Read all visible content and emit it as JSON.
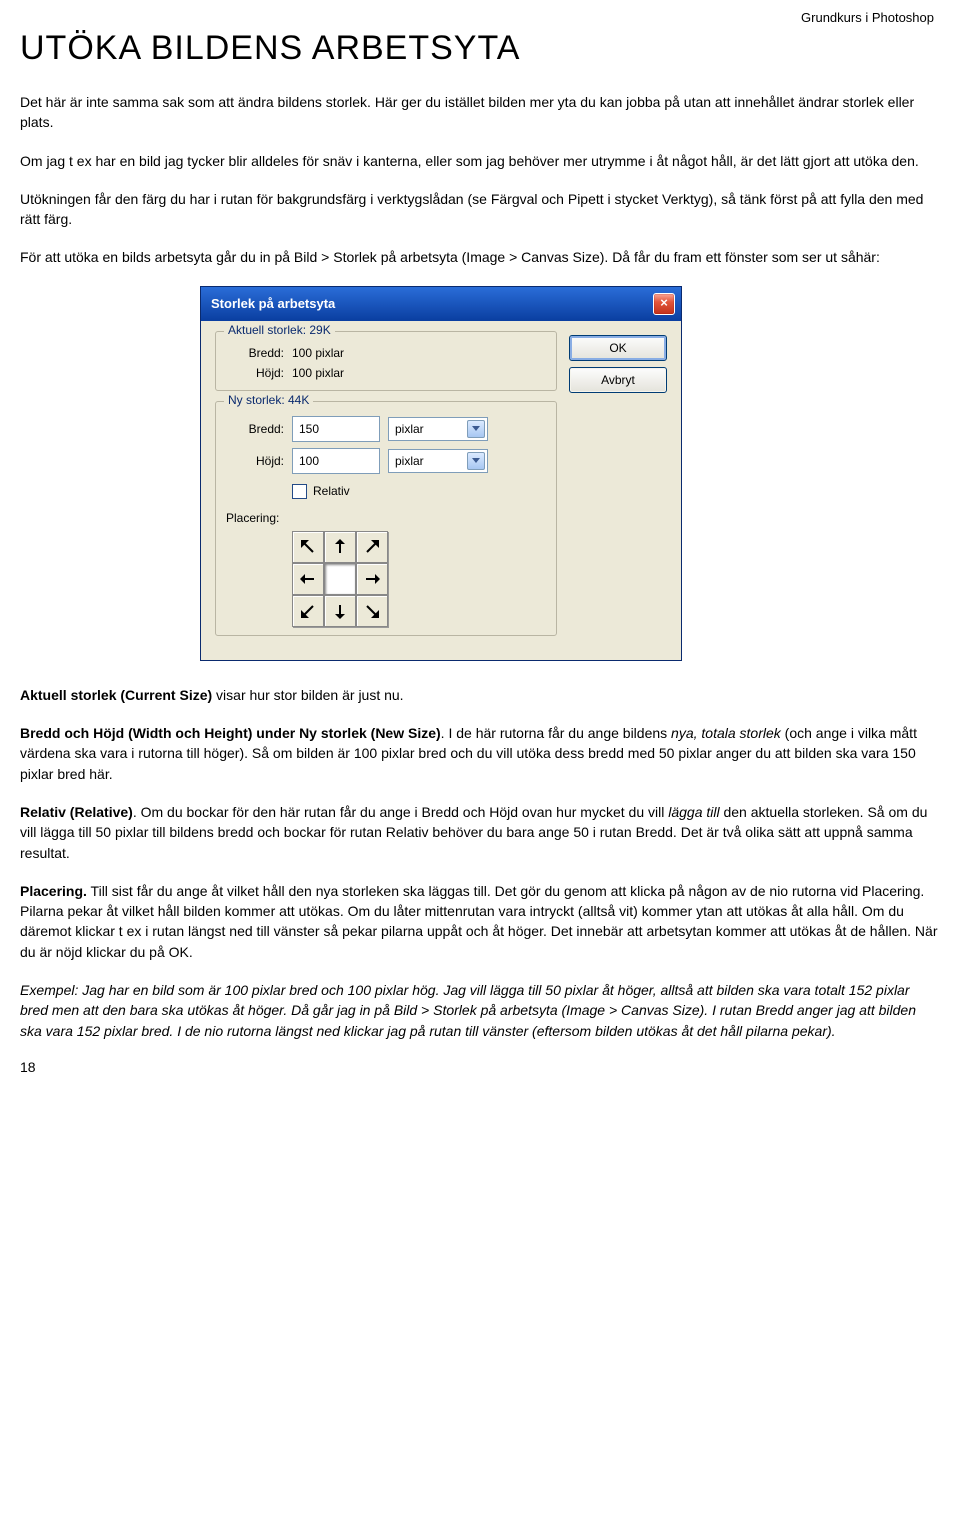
{
  "doc": {
    "header": "Grundkurs i Photoshop",
    "title": "UTÖKA BILDENS ARBETSYTA",
    "p1": "Det här är inte samma sak som att ändra bildens storlek. Här ger du istället bilden mer yta du kan jobba på utan att innehållet ändrar storlek eller plats.",
    "p2": "Om jag t ex har en bild jag tycker blir alldeles för snäv i kanterna, eller som jag behöver mer utrymme i åt något håll, är det lätt gjort att utöka den.",
    "p3": "Utökningen får den färg du har i rutan för bakgrundsfärg i verktygslådan (se Färgval och Pipett i stycket Verktyg), så tänk först på att fylla den med rätt färg.",
    "p4": "För att utöka en bilds arbetsyta går du in på Bild > Storlek på arbetsyta (Image > Canvas Size). Då får du fram ett fönster som ser ut såhär:",
    "after1_b": "Aktuell storlek (Current Size)",
    "after1_rest": " visar hur stor bilden är just nu.",
    "after2_b": "Bredd och Höjd (Width och Height) under Ny storlek (New Size)",
    "after2_rest_a": ". I de här rutorna får du ange bildens ",
    "after2_em": "nya, totala storlek",
    "after2_rest_b": " (och ange i vilka mått värdena ska vara i rutorna till höger). Så om bilden är 100 pixlar bred och du vill utöka dess bredd med 50 pixlar anger du att bilden ska vara 150 pixlar bred här.",
    "after3_b": "Relativ (Relative)",
    "after3_rest_a": ". Om du bockar för den här rutan får du ange i Bredd och Höjd ovan hur mycket du vill ",
    "after3_em": "lägga till",
    "after3_rest_b": " den aktuella storleken. Så om du vill lägga till 50 pixlar till bildens bredd och bockar för rutan Relativ behöver du bara ange 50 i rutan Bredd. Det är två olika sätt att uppnå samma resultat.",
    "after4_b": "Placering.",
    "after4_rest": " Till sist får du ange åt vilket håll den nya storleken ska läggas till. Det gör du genom att klicka på någon av de nio rutorna vid Placering. Pilarna pekar åt vilket håll bilden kommer att utökas. Om du låter mittenrutan vara intryckt (alltså vit) kommer ytan att utökas åt alla håll. Om du däremot klickar t ex i rutan längst ned till vänster så pekar pilarna uppåt och åt höger. Det innebär att arbetsytan kommer att utökas åt de hållen. När du är nöjd klickar du på OK.",
    "example": "Exempel: Jag har en bild som är 100 pixlar bred och 100 pixlar hög. Jag vill lägga till 50 pixlar åt höger, alltså att bilden ska vara totalt 152 pixlar bred men att den bara ska utökas åt höger. Då går jag in på Bild > Storlek på arbetsyta (Image > Canvas Size). I rutan Bredd anger jag att bilden ska vara 152 pixlar bred. I de nio rutorna längst ned klickar jag på rutan till vänster (eftersom bilden utökas åt det håll pilarna pekar).",
    "page_num": "18"
  },
  "dialog": {
    "title": "Storlek på arbetsyta",
    "current_group": "Aktuell storlek: 29K",
    "curr_w_label": "Bredd:",
    "curr_w_val": "100 pixlar",
    "curr_h_label": "Höjd:",
    "curr_h_val": "100 pixlar",
    "new_group": "Ny storlek: 44K",
    "new_w_label": "Bredd:",
    "new_w_val": "150",
    "new_w_unit": "pixlar",
    "new_h_label": "Höjd:",
    "new_h_val": "100",
    "new_h_unit": "pixlar",
    "relative_label": "Relativ",
    "placement_label": "Placering:",
    "ok_label": "OK",
    "cancel_label": "Avbryt"
  }
}
